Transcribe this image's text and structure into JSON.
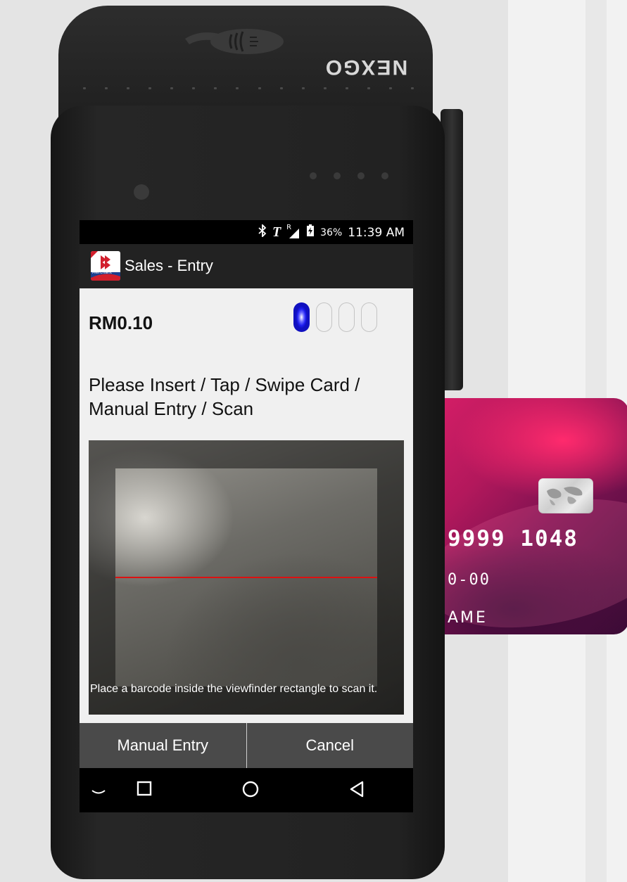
{
  "terminal": {
    "brand": "NEXGO"
  },
  "status_bar": {
    "bluetooth_icon": "bluetooth-icon",
    "carrier_icon": "T",
    "roaming_label": "R",
    "battery_percent": "36%",
    "time": "11:39 AM"
  },
  "app_bar": {
    "logo_text": "Merchant",
    "title": "Sales - Entry"
  },
  "sale": {
    "amount": "RM0.10",
    "steps_total": 4,
    "steps_completed": 1
  },
  "prompt": {
    "text": "Please Insert / Tap / Swipe Card / Manual Entry / Scan"
  },
  "scanner": {
    "hint": "Place a barcode inside the viewfinder rectangle to scan it."
  },
  "buttons": {
    "manual_entry": "Manual Entry",
    "cancel": "Cancel"
  },
  "nav": {
    "icons": [
      "chevron-down-icon",
      "recents-icon",
      "home-icon",
      "back-icon"
    ]
  },
  "card": {
    "number": "9999  1048",
    "expiry": "0-00",
    "name": "AME"
  },
  "colors": {
    "active_step": "#1d1df0",
    "scan_line": "#dd1111",
    "button_bar": "#4a4a4a"
  }
}
